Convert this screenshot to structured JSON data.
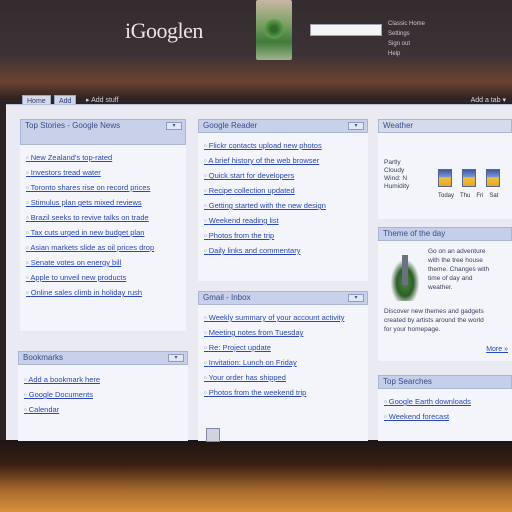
{
  "header": {
    "logo": "iGooglen",
    "search_placeholder": "",
    "links": [
      "Classic Home",
      "Settings",
      "Sign out",
      "Help"
    ]
  },
  "tabs": {
    "home": "Home",
    "add": "Add",
    "more": "▸ Add stuff",
    "tools": "Add a tab  ▾"
  },
  "gadgets": {
    "news": {
      "title": "Top Stories - Google News",
      "items": [
        "New Zealand's top-rated",
        "Investors tread water",
        "Toronto shares rise on record prices",
        "Stimulus plan gets mixed reviews",
        "Brazil seeks to revive talks on trade",
        "Tax cuts urged in new budget plan",
        "Asian markets slide as oil prices drop",
        "Senate votes on energy bill",
        "Apple to unveil new products",
        "Online sales climb in holiday rush"
      ]
    },
    "links": {
      "title": "Google Reader",
      "items": [
        "Flickr contacts upload new photos",
        "A brief history of the web browser",
        "Quick start for developers",
        "Recipe collection updated",
        "Getting started with the new design",
        "Weekend reading list",
        "Photos from the trip",
        "Daily links and commentary"
      ]
    },
    "bottom_left": {
      "title": "Bookmarks",
      "items": [
        "Add a bookmark here",
        "Google Documents",
        "Calendar"
      ]
    },
    "middle_bottom": {
      "title": "Gmail - Inbox",
      "items": [
        "Weekly summary of your account activity",
        "Meeting notes from Tuesday",
        "Re: Project update",
        "Invitation: Lunch on Friday",
        "Your order has shipped",
        "Photos from the weekend trip"
      ]
    },
    "weather": {
      "title": "Weather",
      "left_lines": [
        "Partly",
        "Cloudy",
        "Wind: N",
        "Humidity"
      ],
      "days": [
        "Today",
        "Thu",
        "Fri",
        "Sat"
      ]
    },
    "theme": {
      "title": "Theme of the day",
      "desc_lines": [
        "Go on an adventure",
        "with the tree house",
        "theme. Changes with",
        "time of day and",
        "weather."
      ],
      "desc_bottom": [
        "Discover new themes and gadgets",
        "created by artists around the world",
        "for your homepage."
      ],
      "more_label": "More »"
    },
    "right_bottom": {
      "title": "Top Searches",
      "items": [
        "Google Earth downloads",
        "Weekend forecast"
      ]
    }
  }
}
